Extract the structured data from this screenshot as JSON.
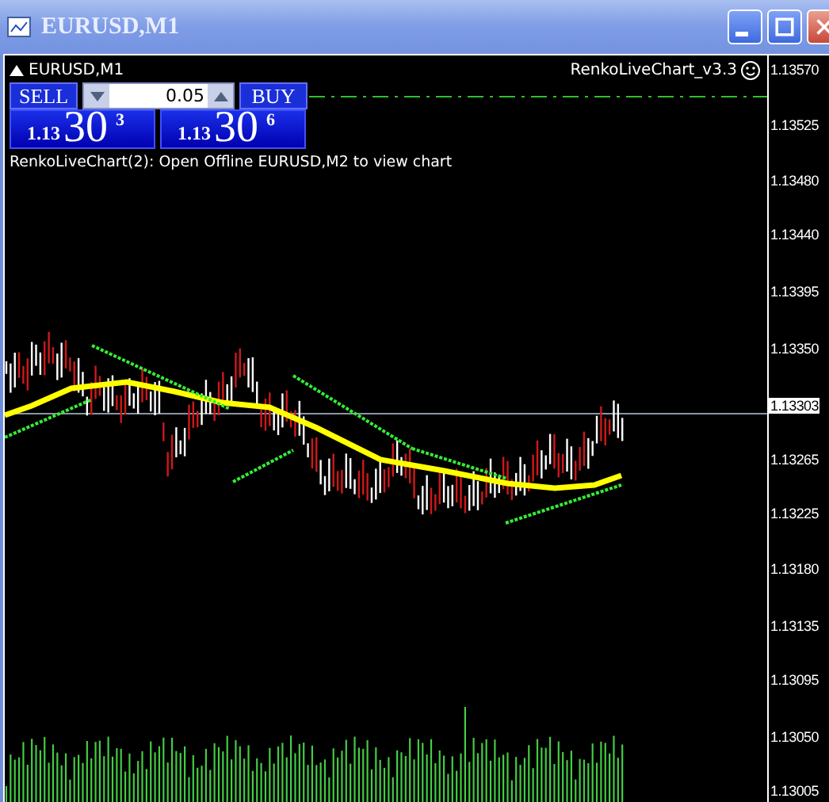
{
  "window": {
    "title": "EURUSD,M1"
  },
  "chart": {
    "symbol_label": "EURUSD,M1",
    "indicator_label": "RenkoLiveChart_v3.3",
    "trade_panel": {
      "sell_label": "SELL",
      "buy_label": "BUY",
      "lot": "0.05",
      "bid": {
        "big": "1.13",
        "main": "30",
        "pip": "3"
      },
      "ask": {
        "big": "1.13",
        "main": "30",
        "pip": "6"
      }
    },
    "message": "RenkoLiveChart(2): Open Offline EURUSD,M2 to view chart",
    "price_axis": [
      "1.13570",
      "1.13525",
      "1.13480",
      "1.13440",
      "1.13395",
      "1.13350",
      "1.13265",
      "1.13225",
      "1.13180",
      "1.13135",
      "1.13095",
      "1.13050",
      "1.13005"
    ],
    "current_price": "1.13303"
  }
}
